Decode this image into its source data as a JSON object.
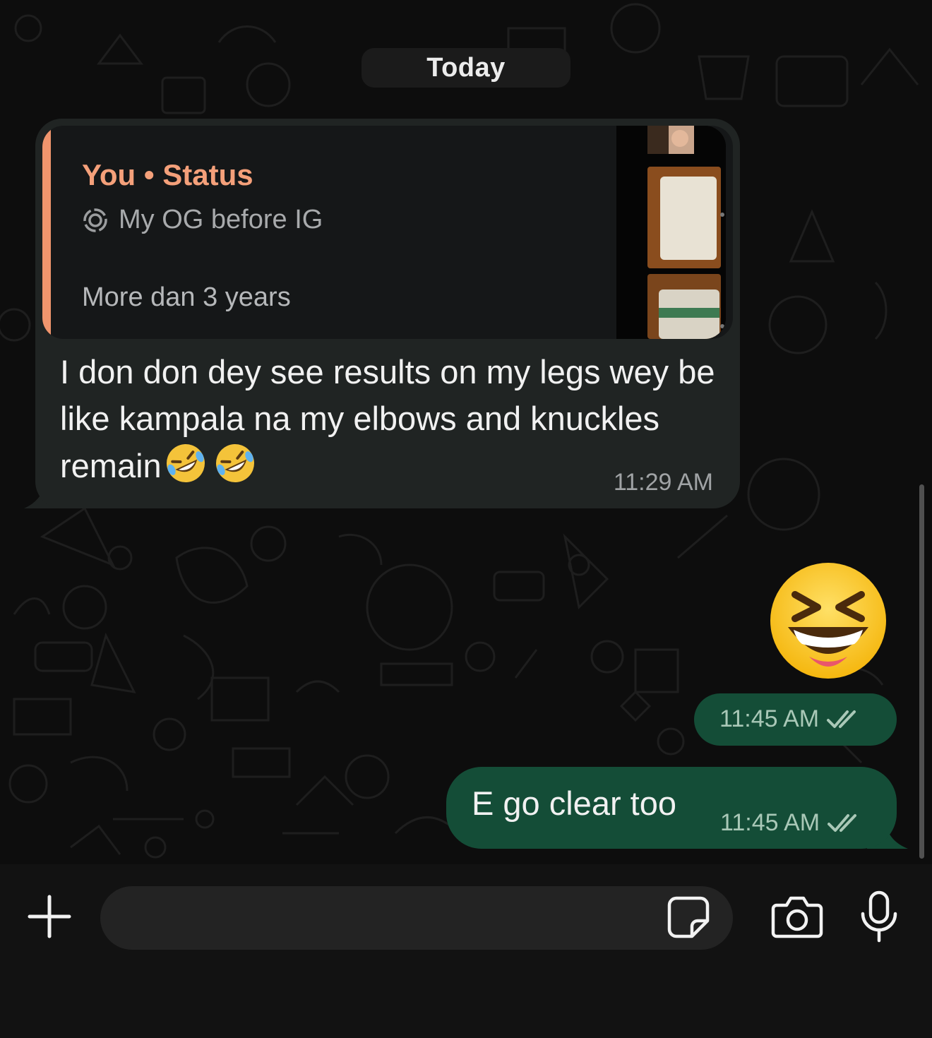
{
  "chat": {
    "date_label": "Today"
  },
  "incoming": {
    "reply_quote": {
      "author": "You",
      "separator": "•",
      "source": "Status",
      "status_icon": "status-ring-icon",
      "status_text": "My OG before IG",
      "caption": "More dan 3 years"
    },
    "text": "I don don dey see results on my legs wey be like kampala na my elbows and knuckles remain",
    "emoji": [
      "rolling-on-floor-laughing",
      "rolling-on-floor-laughing"
    ],
    "time": "11:29 AM"
  },
  "outgoing": [
    {
      "type": "emoji",
      "emoji": "grinning-squinting-face",
      "time": "11:45 AM",
      "status_icon": "double-check-icon"
    },
    {
      "type": "text",
      "text": "E go clear too",
      "time": "11:45 AM",
      "status_icon": "double-check-icon"
    }
  ],
  "composer": {
    "value": "",
    "placeholder": ""
  },
  "colors": {
    "background": "#0d0d0d",
    "incoming_bubble": "#202423",
    "outgoing_bubble": "#144d37",
    "quote_accent": "#f0956d",
    "quote_author": "#f4a07a",
    "read_check": "#a9c8b7"
  }
}
